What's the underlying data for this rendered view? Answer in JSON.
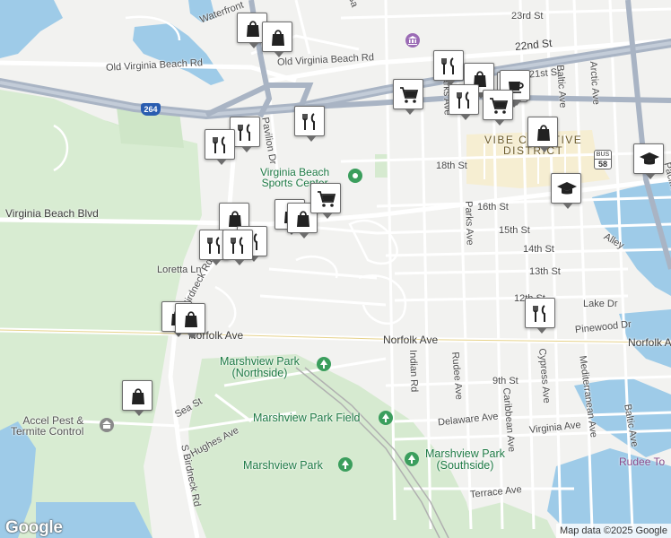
{
  "map": {
    "attribution": "Map data ©2025 Google",
    "logo": "Google",
    "interstate": "264",
    "bus_route": {
      "top": "BUS",
      "num": "58"
    },
    "district": "VIBE CREATIVE DISTRICT",
    "district_line1": "VIBE CREATIVE",
    "district_line2": "DISTRICT",
    "streets": {
      "waterfront": "Waterfront",
      "old_vb_rd_w": "Old Virginia Beach Rd",
      "old_vb_rd_e": "Old Virginia Beach Rd",
      "st23": "23rd St",
      "st22": "22nd St",
      "st21": "21st St",
      "st18": "18th St",
      "st16": "16th St",
      "st15": "15th St",
      "st14": "14th St",
      "st13": "13th St",
      "st12": "12th St",
      "st9": "9th St",
      "vb_blvd": "Virginia Beach Blvd",
      "pavilion": "Pavilion Dr",
      "loretta": "Loretta Ln",
      "birdneck_n": "Birdneck Rd",
      "birdneck_s": "S Birdneck Rd",
      "norfolk_w": "Norfolk Ave",
      "norfolk_c": "Norfolk Ave",
      "norfolk_e": "Norfolk Ave",
      "sea": "Sea St",
      "hughes": "Hughes Ave",
      "indian": "Indian Rd",
      "rudee_ave": "Rudee Ave",
      "caribbean": "Caribbean Ave",
      "cypress": "Cypress Ave",
      "mediterranean": "Mediterranean Ave",
      "baltic_n": "Baltic Ave",
      "baltic_s": "Baltic Ave",
      "arctic": "Arctic Ave",
      "parks_n": "Parks Ave",
      "parks": "Parks Ave",
      "pacific": "Pacific Ave",
      "delaware": "Delaware Ave",
      "virginia_ave": "Virginia Ave",
      "terrace": "Terrace Ave",
      "lake": "Lake Dr",
      "pinewood": "Pinewood Dr",
      "alley": "Alley",
      "balt_top": "Ba"
    },
    "places": {
      "sports_center_1": "Virginia Beach",
      "sports_center_2": "Sports Center",
      "marsh_north_1": "Marshview Park",
      "marsh_north_2": "(Northside)",
      "marsh_field": "Marshview Park Field",
      "marsh_park": "Marshview Park",
      "marsh_south_1": "Marshview Park",
      "marsh_south_2": "(Southside)",
      "accel_1": "Accel Pest &",
      "accel_2": "Termite Control",
      "rudee_tower": "Rudee To"
    },
    "colors": {
      "land": "#f2f2f0",
      "water": "#9ecbe8",
      "park": "#d6ead0",
      "highway": "#a9b4c4",
      "road": "#ffffff",
      "district": "#f6eed2"
    },
    "markers": [
      {
        "icon": "shopping-bag-icon",
        "name": "marker-shopping-1"
      },
      {
        "icon": "shopping-bag-icon",
        "name": "marker-shopping-2"
      },
      {
        "icon": "restaurant-icon",
        "name": "marker-restaurant-1"
      },
      {
        "icon": "restaurant-icon",
        "name": "marker-restaurant-2"
      },
      {
        "icon": "restaurant-icon",
        "name": "marker-restaurant-3"
      },
      {
        "icon": "shopping-bag-icon",
        "name": "marker-shopping-3"
      },
      {
        "icon": "shopping-bag-icon",
        "name": "marker-shopping-4"
      },
      {
        "icon": "shopping-cart-icon",
        "name": "marker-grocery-1"
      },
      {
        "icon": "restaurant-icon",
        "name": "marker-restaurant-4"
      },
      {
        "icon": "restaurant-icon",
        "name": "marker-restaurant-5"
      },
      {
        "icon": "shopping-bag-icon",
        "name": "marker-shopping-5"
      },
      {
        "icon": "shopping-bag-icon",
        "name": "marker-shopping-6"
      },
      {
        "icon": "shopping-bag-icon",
        "name": "marker-shopping-7"
      },
      {
        "icon": "restaurant-icon",
        "name": "marker-restaurant-6"
      },
      {
        "icon": "shopping-bag-icon",
        "name": "marker-shopping-8"
      },
      {
        "icon": "shopping-cart-icon",
        "name": "marker-grocery-2"
      },
      {
        "icon": "restaurant-icon",
        "name": "marker-restaurant-7"
      },
      {
        "icon": "shopping-bag-icon",
        "name": "marker-shopping-9"
      },
      {
        "icon": "coffee-icon",
        "name": "marker-cafe-1"
      },
      {
        "icon": "restaurant-icon",
        "name": "marker-restaurant-8"
      },
      {
        "icon": "shopping-cart-icon",
        "name": "marker-grocery-3"
      },
      {
        "icon": "shopping-bag-icon",
        "name": "marker-shopping-10"
      },
      {
        "icon": "graduation-cap-icon",
        "name": "marker-school-1"
      },
      {
        "icon": "graduation-cap-icon",
        "name": "marker-school-2"
      },
      {
        "icon": "restaurant-icon",
        "name": "marker-restaurant-9"
      },
      {
        "icon": "shopping-bag-icon",
        "name": "marker-shopping-11"
      }
    ]
  }
}
